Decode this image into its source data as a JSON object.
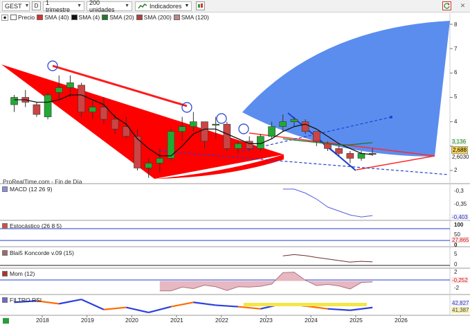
{
  "toolbar": {
    "ticker": "GEST",
    "period_short": "D",
    "timeframe": "1 trimestre",
    "units": "200 unidades",
    "indicators": "Indicadores"
  },
  "legend": {
    "price": "Precio",
    "sma40": "SMA (40)",
    "sma4": "SMA (4)",
    "sma20": "SMA (20)",
    "sma200": "SMA (200)",
    "sma120": "SMA (120)"
  },
  "credit": "ProRealTime.com - Fin de Día",
  "panels": {
    "macd": "MACD (12 26 9)",
    "stoch": "Estocástico (26 8 5)",
    "blai": "Blai5 Koncorde v.09 (15)",
    "mom": "Mom (12)",
    "filtro": "FILTRO RSI"
  },
  "price_axis": [
    "8",
    "7",
    "6",
    "5",
    "4",
    "3,136",
    "2,688",
    "2,6030",
    "2"
  ],
  "macd_axis": [
    "-0,3",
    "-0,35",
    "-0,403"
  ],
  "stoch_axis": [
    "100",
    "50",
    "27,865",
    "0"
  ],
  "blai_axis": [
    "5",
    "0"
  ],
  "mom_axis": [
    "2",
    "-0,252",
    "-2"
  ],
  "filtro_axis": [
    "42,827",
    "41,387"
  ],
  "x_labels": [
    "2018",
    "2019",
    "2020",
    "2021",
    "2022",
    "2023",
    "2024",
    "2025",
    "2026"
  ],
  "colors": {
    "up_candle": "#22aa33",
    "down_candle": "#cc4444",
    "red_zone": "#ff0000",
    "blue_zone": "#5b8def",
    "trend_blue": "#1f3fd0",
    "price_tag": "#f5d24a",
    "mom_fill": "#e6b8c2"
  },
  "icons": {
    "chart_type": "candlestick-icon",
    "indicators": "indicator-chart-icon",
    "refresh": "refresh-icon",
    "close": "close-icon"
  },
  "chart_data": [
    {
      "type": "candlestick",
      "title": "GEST",
      "timeframe": "1 trimestre",
      "x": [
        "2017-Q2",
        "2017-Q3",
        "2017-Q4",
        "2018-Q1",
        "2018-Q2",
        "2018-Q3",
        "2018-Q4",
        "2019-Q1",
        "2019-Q2",
        "2019-Q3",
        "2019-Q4",
        "2020-Q1",
        "2020-Q2",
        "2020-Q3",
        "2020-Q4",
        "2021-Q1",
        "2021-Q2",
        "2021-Q3",
        "2021-Q4",
        "2022-Q1",
        "2022-Q2",
        "2022-Q3",
        "2022-Q4",
        "2023-Q1",
        "2023-Q2",
        "2023-Q3",
        "2023-Q4",
        "2024-Q1",
        "2024-Q2",
        "2024-Q3",
        "2024-Q4",
        "2025-Q1",
        "2025-Q2"
      ],
      "series": [
        {
          "name": "Precio",
          "ohlc": [
            [
              4.7,
              5.1,
              4.4,
              5.0
            ],
            [
              5.0,
              5.3,
              4.6,
              4.8
            ],
            [
              4.7,
              4.8,
              4.2,
              4.3
            ],
            [
              4.2,
              5.2,
              4.1,
              5.1
            ],
            [
              5.2,
              5.9,
              4.9,
              5.4
            ],
            [
              5.4,
              5.9,
              5.0,
              5.6
            ],
            [
              5.5,
              5.6,
              4.2,
              4.4
            ],
            [
              4.4,
              4.9,
              4.1,
              4.6
            ],
            [
              4.6,
              5.0,
              3.9,
              4.1
            ],
            [
              4.1,
              4.3,
              3.5,
              3.7
            ],
            [
              3.8,
              4.2,
              3.3,
              3.4
            ],
            [
              3.4,
              3.7,
              2.0,
              2.1
            ],
            [
              2.1,
              2.5,
              1.7,
              2.3
            ],
            [
              2.3,
              2.9,
              1.9,
              2.5
            ],
            [
              2.5,
              3.7,
              2.4,
              3.6
            ],
            [
              3.6,
              4.2,
              3.2,
              3.8
            ],
            [
              3.8,
              4.4,
              3.6,
              4.0
            ],
            [
              4.0,
              4.0,
              2.9,
              3.2
            ],
            [
              3.9,
              4.2,
              3.3,
              3.9
            ],
            [
              3.9,
              4.0,
              2.8,
              2.9
            ],
            [
              2.9,
              3.2,
              2.7,
              3.1
            ],
            [
              3.2,
              3.4,
              2.8,
              2.9
            ],
            [
              2.9,
              3.5,
              2.8,
              3.4
            ],
            [
              3.4,
              4.0,
              3.3,
              3.8
            ],
            [
              3.8,
              4.3,
              3.6,
              4.0
            ],
            [
              4.0,
              4.2,
              3.8,
              4.1
            ],
            [
              4.0,
              4.1,
              3.5,
              3.6
            ],
            [
              3.6,
              3.6,
              3.0,
              3.2
            ],
            [
              3.1,
              3.2,
              2.8,
              2.9
            ],
            [
              2.9,
              3.0,
              2.6,
              2.7
            ],
            [
              2.7,
              2.8,
              2.3,
              2.5
            ],
            [
              2.5,
              2.8,
              2.4,
              2.7
            ],
            [
              2.7,
              2.9,
              2.6,
              2.69
            ]
          ]
        },
        {
          "name": "SMA (4)",
          "values": [
            4.9,
            4.9,
            4.8,
            4.8,
            4.9,
            5.1,
            5.1,
            4.9,
            4.7,
            4.2,
            3.9,
            3.3,
            2.9,
            2.6,
            2.6,
            3.0,
            3.5,
            3.7,
            3.7,
            3.5,
            3.3,
            3.1,
            3.1,
            3.3,
            3.6,
            3.8,
            3.9,
            3.7,
            3.4,
            3.1,
            2.9,
            2.7,
            2.65
          ]
        },
        {
          "name": "SMA (20)",
          "values": [
            null,
            null,
            null,
            null,
            null,
            null,
            null,
            null,
            null,
            null,
            null,
            null,
            null,
            null,
            null,
            null,
            null,
            null,
            null,
            null,
            null,
            null,
            null,
            null,
            3.3,
            3.25,
            3.2,
            3.15,
            3.1,
            3.05,
            3.05,
            3.1,
            3.14
          ]
        }
      ],
      "ylabel": "",
      "xlabel": "",
      "ylim": [
        1.5,
        8.5
      ]
    },
    {
      "type": "line",
      "title": "MACD (12 26 9)",
      "x": [
        "2023-Q2",
        "2023-Q3",
        "2023-Q4",
        "2024-Q1",
        "2024-Q2",
        "2024-Q3",
        "2024-Q4",
        "2025-Q1",
        "2025-Q2"
      ],
      "series": [
        {
          "name": "MACD (12 26 9)",
          "values": [
            -0.27,
            -0.27,
            -0.29,
            -0.32,
            -0.36,
            -0.38,
            -0.4,
            -0.41,
            -0.403
          ]
        }
      ],
      "ylim": [
        -0.42,
        -0.26
      ]
    },
    {
      "type": "line",
      "title": "Blai5 Koncorde v.09 (15)",
      "x": [
        "2023-Q2",
        "2023-Q3",
        "2023-Q4",
        "2024-Q1",
        "2024-Q2",
        "2024-Q3",
        "2024-Q4",
        "2025-Q1",
        "2025-Q2"
      ],
      "series": [
        {
          "name": "Blai5 Koncorde v.09 (15)",
          "values": [
            3.5,
            4.0,
            3.6,
            2.9,
            2.3,
            1.7,
            1.1,
            1.4,
            1.2
          ]
        }
      ],
      "ylim": [
        -1,
        6
      ]
    },
    {
      "type": "area",
      "title": "Mom (12)",
      "x": [
        "2020-Q3",
        "2020-Q4",
        "2021-Q1",
        "2021-Q2",
        "2021-Q3",
        "2021-Q4",
        "2022-Q1",
        "2022-Q2",
        "2022-Q3",
        "2022-Q4",
        "2023-Q1",
        "2023-Q2",
        "2023-Q3",
        "2023-Q4",
        "2024-Q1",
        "2024-Q2",
        "2024-Q3",
        "2024-Q4",
        "2025-Q1",
        "2025-Q2"
      ],
      "series": [
        {
          "name": "Mom (12)",
          "values": [
            -2.6,
            -2.6,
            -1.6,
            -2.0,
            -1.1,
            -1.5,
            -2.5,
            -1.5,
            -1.6,
            -1.4,
            -0.8,
            2.2,
            2.3,
            0.2,
            -1.2,
            -0.9,
            -1.3,
            -2.1,
            -0.4,
            -0.252
          ]
        }
      ],
      "ylim": [
        -3,
        2.8
      ]
    },
    {
      "type": "line",
      "title": "FILTRO RSI",
      "x": [
        "2017-Q2",
        "2017-Q4",
        "2018-Q2",
        "2018-Q4",
        "2019-Q2",
        "2019-Q4",
        "2020-Q2",
        "2020-Q4",
        "2021-Q2",
        "2021-Q4",
        "2022-Q2",
        "2022-Q4",
        "2023-Q2",
        "2023-Q4",
        "2024-Q2",
        "2024-Q4",
        "2025-Q2"
      ],
      "series": [
        {
          "name": "FILTRO RSI",
          "values": [
            50,
            52,
            48,
            54,
            40,
            43,
            36,
            44,
            50,
            46,
            44,
            41,
            48,
            45,
            41,
            39,
            42.827
          ]
        },
        {
          "name": "",
          "values": [
            null,
            null,
            null,
            null,
            null,
            null,
            null,
            null,
            null,
            null,
            null,
            41.4,
            41.4,
            41.4,
            41.4,
            41.4,
            41.387
          ]
        }
      ],
      "ylim": [
        34,
        56
      ]
    }
  ]
}
